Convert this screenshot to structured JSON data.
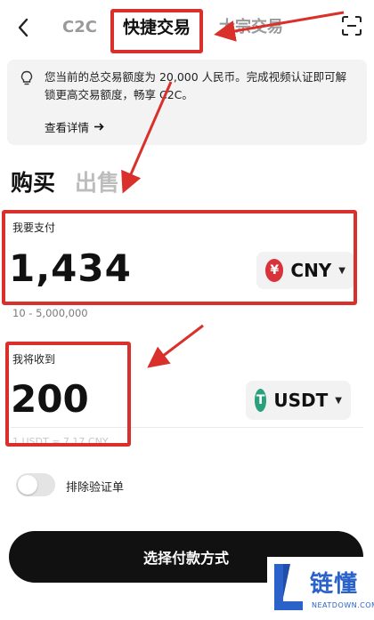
{
  "header": {
    "tabs": [
      "C2C",
      "快捷交易",
      "大宗交易"
    ],
    "active_tab": "快捷交易"
  },
  "info": {
    "text": "您当前的总交易额度为 20,000 人民币。完成视频认证即可解锁更高交易额度，畅享 C2C。",
    "link_label": "查看详情"
  },
  "side_tabs": {
    "buy": "购买",
    "sell": "出售"
  },
  "pay": {
    "label": "我要支付",
    "amount": "1,434",
    "currency": "CNY",
    "currency_symbol": "¥",
    "range": "10 - 5,000,000"
  },
  "receive": {
    "label": "我将收到",
    "amount": "200",
    "currency": "USDT",
    "currency_symbol": "T",
    "rate": "1 USDT ≈ 7.17 CNY"
  },
  "toggle": {
    "label": "排除验证单",
    "on": false
  },
  "cta": {
    "label": "选择付款方式"
  },
  "watermark": {
    "cn": "链懂",
    "en": "NEATDOWN.COM"
  },
  "colors": {
    "highlight": "#d9302b",
    "cta_bg": "#111111",
    "cny_coin": "#d8323a",
    "usdt_coin": "#28a17c",
    "watermark": "#2a62c9"
  },
  "icons": [
    "back-icon",
    "scan-icon",
    "lightbulb-icon",
    "arrow-right-icon",
    "caret-down-icon"
  ]
}
